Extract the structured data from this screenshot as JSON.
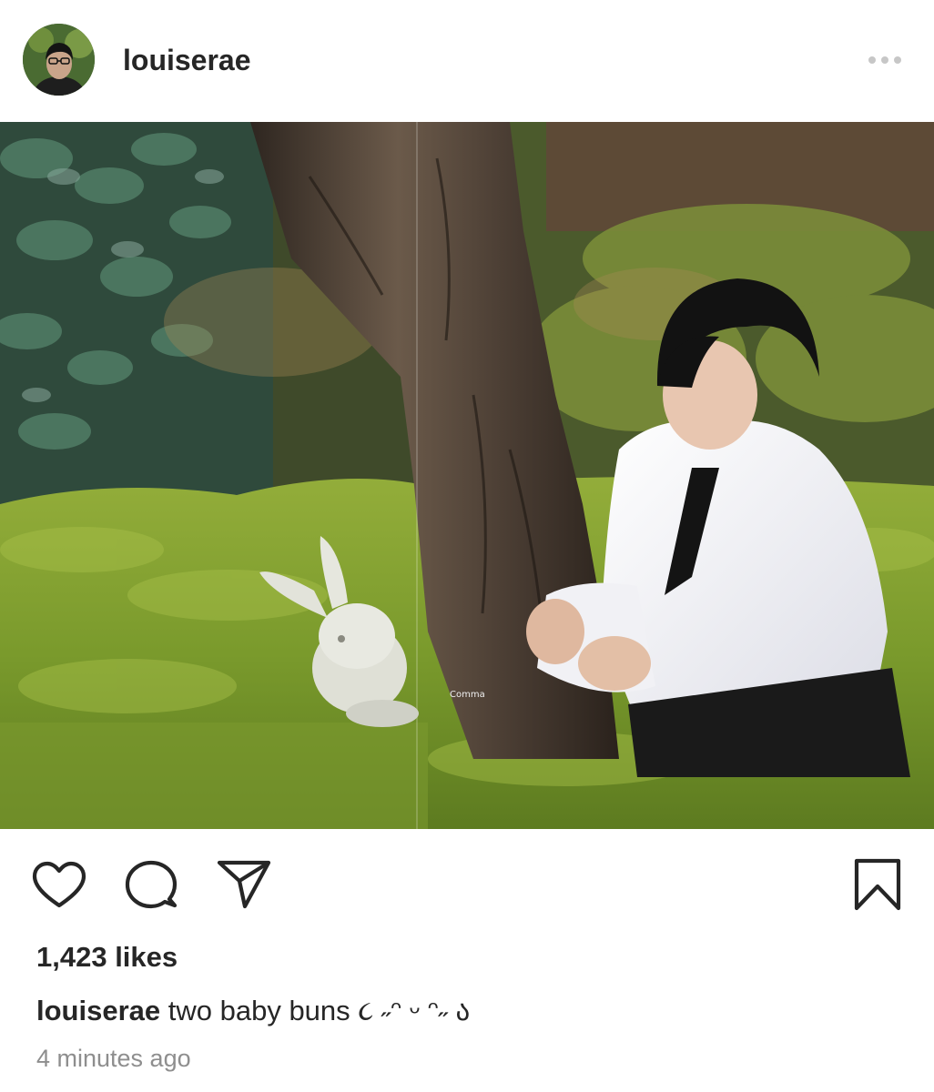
{
  "post": {
    "username": "louiserae",
    "image_watermark": "Comma",
    "likes": "1,423 likes",
    "caption_username": "louiserae",
    "caption_text": "two baby buns ૮ ˶ᵔ ᵕ ᵔ˶ ა",
    "timestamp": "4 minutes ago"
  },
  "icons": {
    "more": "more-options-icon",
    "like": "heart-icon",
    "comment": "comment-bubble-icon",
    "share": "paper-plane-icon",
    "save": "bookmark-icon"
  },
  "colors": {
    "text": "#262626",
    "muted": "#8e8e8e",
    "icon": "#262626",
    "background": "#ffffff"
  }
}
